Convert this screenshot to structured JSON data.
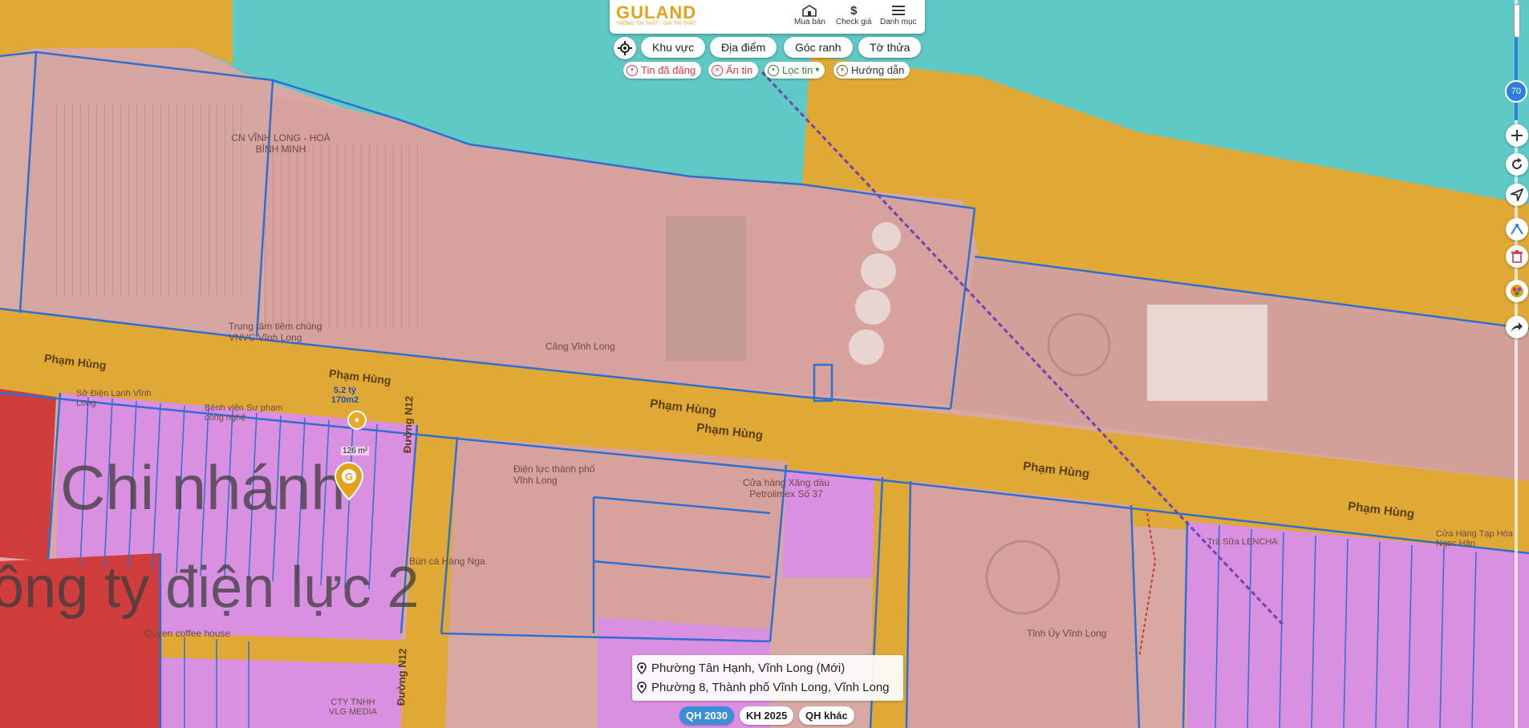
{
  "app": {
    "logo": "GULAND",
    "logo_tagline": "THÔNG TIN THẬT - GIÁ TRỊ THẬT",
    "top_nav": [
      {
        "label": "Mua bán",
        "icon": "shop-icon"
      },
      {
        "label": "Check giá",
        "icon": "dollar-icon"
      },
      {
        "label": "Danh mục",
        "icon": "menu-icon"
      }
    ]
  },
  "toolbar": {
    "tabs": [
      "Khu vực",
      "Địa điểm",
      "Góc ranh",
      "Tờ thửa"
    ],
    "filters": [
      {
        "label": "Tin đã đăng",
        "icon": "pin-icon",
        "color": "#d9364a"
      },
      {
        "label": "Ẩn tin",
        "icon": "close-circle-icon",
        "color": "#d9364a"
      },
      {
        "label": "Lọc tin",
        "icon": "filter-icon",
        "color": "#2e8b3a"
      },
      {
        "label": "Hướng dẫn",
        "icon": "guide-icon",
        "color": "#7a5a1a"
      }
    ]
  },
  "side_controls": {
    "opacity_value": "70",
    "buttons": [
      "zoom-in-icon",
      "refresh-icon",
      "locate-icon",
      "measure-icon",
      "trash-icon",
      "layers-icon",
      "share-icon"
    ]
  },
  "map_labels": {
    "streets": [
      "Phạm Hùng",
      "Phạm Hùng",
      "Phạm Hùng",
      "Phạm Hùng",
      "Phạm Hùng",
      "Phạm Hùng",
      "Đường N12",
      "Đường N12"
    ],
    "pois": [
      "CN VĨNH LONG - HOÀ BÌNH MINH",
      "Trung tâm tiêm chủng VNVC Vĩnh Long",
      "Cảng Vĩnh Long",
      "Sở Điện Lạnh Vĩnh Long",
      "Bệnh viện Sư phạm công nghệ",
      "Điện lực thành phố Vĩnh Long",
      "Cửa hàng Xăng dầu Petrolimex Số 37",
      "Bún cá Hàng Nga",
      "Quyen coffee house",
      "CTY TNHH VLG MEDIA",
      "Tỉnh Ủy Vĩnh Long",
      "Trà Sữa LENCHA",
      "Cửa Hàng Tạp Hóa Ngọc Hân"
    ],
    "overlay_text_line1": "Chi nhánh",
    "overlay_text_line2": "ông ty điện lực 2"
  },
  "listing": {
    "price": "5.2 tỷ",
    "area": "170m2",
    "lot_area": "126 m²"
  },
  "address": {
    "line1": "Phường Tân Hạnh, Vĩnh Long (Mới)",
    "line2": "Phường 8, Thành phố Vĩnh Long, Vĩnh Long"
  },
  "planning_tabs": [
    {
      "label": "QH 2030",
      "active": true
    },
    {
      "label": "KH 2025",
      "active": false
    },
    {
      "label": "QH khác",
      "active": false
    }
  ],
  "colors": {
    "water": "#5fc9c6",
    "road_yellow": "#e0a935",
    "commercial_pink": "#d7a29e",
    "residential_magenta": "#d990e0",
    "public_red": "#cf3d3d",
    "parcel_border": "#2f6fd1",
    "brand": "#e5a11a",
    "active_tab": "#3b8fd9"
  }
}
